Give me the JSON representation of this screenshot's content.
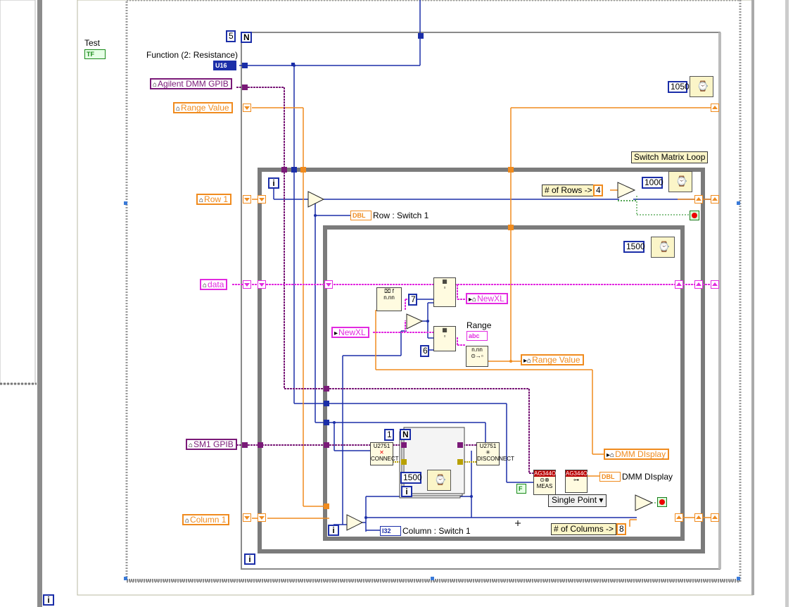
{
  "labels": {
    "test": "Test",
    "function": "Function (2: Resistance)",
    "switch_matrix_loop": "Switch Matrix Loop",
    "row_switch": "Row : Switch 1",
    "range": "Range",
    "column_switch": "Column : Switch 1",
    "dmm_display": "DMM DIsplay"
  },
  "controls": {
    "agilent_gpib": "Agilent DMM GPIB",
    "range_value": "Range Value",
    "row1": "Row 1",
    "data": "data",
    "newxl_in": "NewXL",
    "newxl_out": "NewXL",
    "range_value_out": "Range Value",
    "sm1_gpib": "SM1 GPIB",
    "column1": "Column 1",
    "dmm_display_out": "DMM DIsplay"
  },
  "constants": {
    "loop_count": "5",
    "n_label": "N",
    "u16": "U16",
    "wait_1050": "1050",
    "rows_note": "# of Rows ->",
    "rows_value": "4",
    "wait_1000": "1000",
    "wait_1500_inner": "1500",
    "index_7": "7",
    "index_6": "6",
    "inner_count": "1",
    "wait_1500_seq": "1500",
    "single_point": "Single Point",
    "false_const": "F",
    "cols_note": "# of Columns ->",
    "cols_value": "8",
    "iter": "i",
    "tf": "TF",
    "dbl": "DBL",
    "i32": "I32",
    "abc": "abc"
  },
  "subvis": {
    "connect_title": "U2751",
    "connect_label": "CONNECT",
    "disconnect_title": "U2751",
    "disconnect_label": "DISCONNECT",
    "meas_title": "AG344OX",
    "meas_label": "MEAS"
  },
  "colors": {
    "orange": "#f08b1e",
    "blue": "#1b2ea8",
    "purple": "#7a1a78",
    "pink": "#e22ae0",
    "green": "#1a8a1a",
    "loop_gray": "#7b7b7b"
  }
}
